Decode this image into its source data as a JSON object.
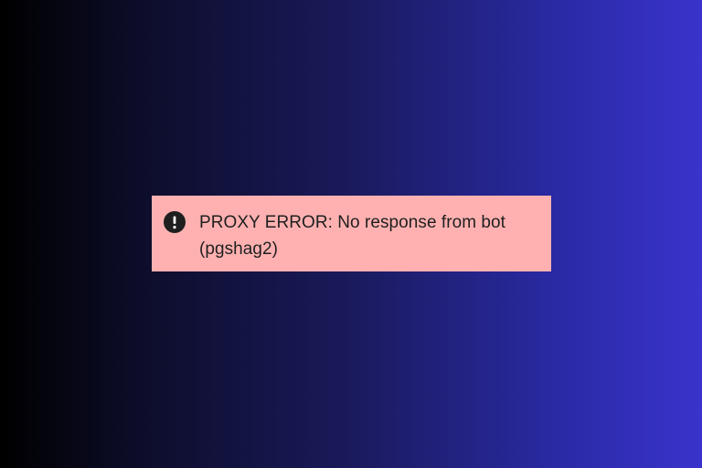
{
  "theme": {
    "banner_background": "#ffb1b1",
    "banner_text_color": "#1f1f1f",
    "icon_color": "#1f1f1f"
  },
  "error_banner": {
    "icon": "exclamation-circle-icon",
    "message": "PROXY ERROR: No response from bot (pgshag2)"
  }
}
